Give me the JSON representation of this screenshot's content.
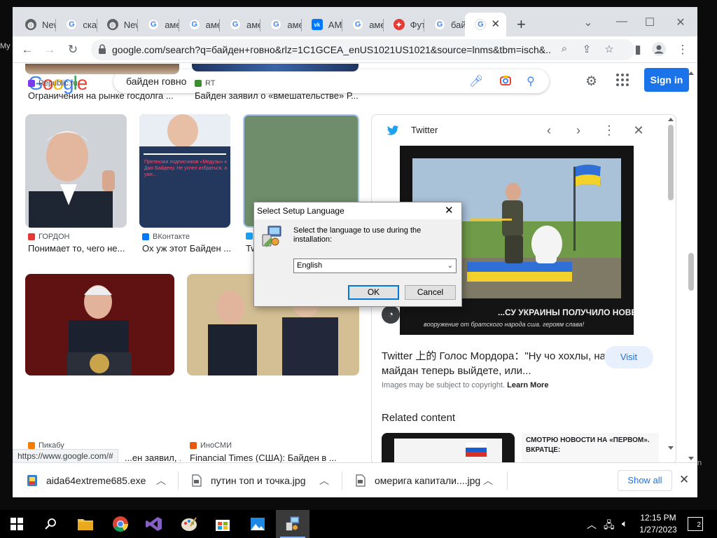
{
  "desktop": {
    "left_text": "My",
    "right_text": "n"
  },
  "tabs": [
    {
      "label": "New",
      "fav": "globe"
    },
    {
      "label": "ска",
      "fav": "g"
    },
    {
      "label": "New",
      "fav": "globe"
    },
    {
      "label": "аме",
      "fav": "g"
    },
    {
      "label": "аме",
      "fav": "g"
    },
    {
      "label": "аме",
      "fav": "g"
    },
    {
      "label": "аме",
      "fav": "g"
    },
    {
      "label": "АМ",
      "fav": "vk"
    },
    {
      "label": "аме",
      "fav": "g"
    },
    {
      "label": "Фут",
      "fav": "red"
    },
    {
      "label": "бай",
      "fav": "g"
    },
    {
      "label": "",
      "fav": "g"
    }
  ],
  "window_controls": {
    "chevron": "⌄",
    "minimize": "—",
    "maximize": "☐",
    "close": "✕"
  },
  "toolbar": {
    "url": "google.com/search?q=байден+говно&rlz=1C1GCEA_enUS1021US1021&source=lnms&tbm=isch&..."
  },
  "google": {
    "logo": [
      "G",
      "o",
      "o",
      "g",
      "l",
      "e"
    ],
    "query": "байден говно",
    "signin": "Sign in"
  },
  "results": [
    {
      "source": "Republic.ru",
      "title": "Ограничения на рынке госдолга ..."
    },
    {
      "source": "RT",
      "title": "Байден заявил о «вмешательстве» Р..."
    },
    {
      "source": "ГОРДОН",
      "title": "Понимает то, чего не..."
    },
    {
      "source": "ВКонтакте",
      "title": "Ох уж этот Байден ..."
    },
    {
      "source": "",
      "title": "Tw"
    },
    {
      "source": "Пикабу",
      "title": "...ен заявил, ..."
    },
    {
      "source": "ИноСМИ",
      "title": "Financial Times (США): Байден в ..."
    }
  ],
  "meduza_card": {
    "header": "Претензии подписчиков «Медузы» к Джо Байдену. Не успел избраться, а уже..."
  },
  "panel": {
    "site": "Twitter",
    "image_top_text": "",
    "image_caption_1": "...СУ УКРАИНЫ ПОЛУЧИЛО НОВЕЙШЕЕ",
    "image_caption_2": "вооружение от братского народа сша. героям слава!",
    "caption": "Twitter 上的 Голос Мордора：\"Ну чо хохлы, на майдан теперь выйдете, или...",
    "visit": "Visit",
    "copyright": "Images may be subject to copyright.",
    "learn_more": "Learn More",
    "related": "Related content",
    "related_text": "СМОТРЮ НОВОСТИ НА «ПЕРВОМ». ВКРАТЦЕ:"
  },
  "status_url": "https://www.google.com/#",
  "downloads": [
    {
      "name": "aida64extreme685.exe"
    },
    {
      "name": "путин топ и точка.jpg"
    },
    {
      "name": "омерига капитали....jpg"
    }
  ],
  "downloads_bar": {
    "show_all": "Show all"
  },
  "dialog": {
    "title": "Select Setup Language",
    "message": "Select the language to use during the installation:",
    "selected_language": "English",
    "ok": "OK",
    "cancel": "Cancel"
  },
  "taskbar": {
    "time": "12:15 PM",
    "date": "1/27/2023",
    "notifications": "2"
  }
}
